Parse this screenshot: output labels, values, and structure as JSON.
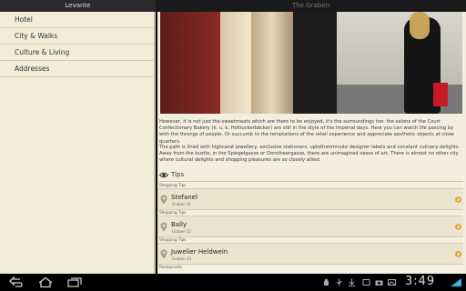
{
  "app": {
    "left_title": "Levante",
    "center_title": "The Graben"
  },
  "sidebar": {
    "items": [
      {
        "label": "Hotel"
      },
      {
        "label": "City & Walks"
      },
      {
        "label": "Culture & Living"
      },
      {
        "label": "Addresses"
      }
    ]
  },
  "article": {
    "paragraph1": "However, it is not just the sweetmeats which are there to be enjoyed, it's the surroundings too: the salons of the Court Confectionary Bakery (k. u. k. Hofzuckerbäcker) are still in the style of the Imperial days. Here you can watch life passing by with the throngs of people. Or succumb to the temptations of the retail experience and appreciate aesthetic objects at close quarters.",
    "paragraph2": "The path is lined with highcarat jewellery, exclusive stationers, uptothenminute designer labels and constant culinary delights. Away from the bustle, in the Spiegelgasse or Dorotheergasse, there are unimagined oases of art. There is almost no other city where cultural delights and shopping pleasures are so closely allied."
  },
  "tips": {
    "heading": "Tips",
    "items": [
      {
        "category": "Shopping Tips",
        "name": "Stefanel",
        "address": "Graben 31"
      },
      {
        "category": "Shopping Tips",
        "name": "Bally",
        "address": "Graben 12"
      },
      {
        "category": "Shopping Tips",
        "name": "Juwelier Heldwein",
        "address": "Graben 13"
      }
    ],
    "next_category": "Restaurants"
  },
  "status_bar": {
    "clock": "3:49"
  },
  "colors": {
    "sidebar_bg": "#f3ecd8",
    "content_bg": "#f4eedf",
    "accent": "#d9a52e"
  },
  "icons": [
    "eye-icon",
    "map-pin-icon",
    "chevron-right-icon",
    "back-icon",
    "home-icon",
    "recent-apps-icon",
    "signal-icon"
  ]
}
